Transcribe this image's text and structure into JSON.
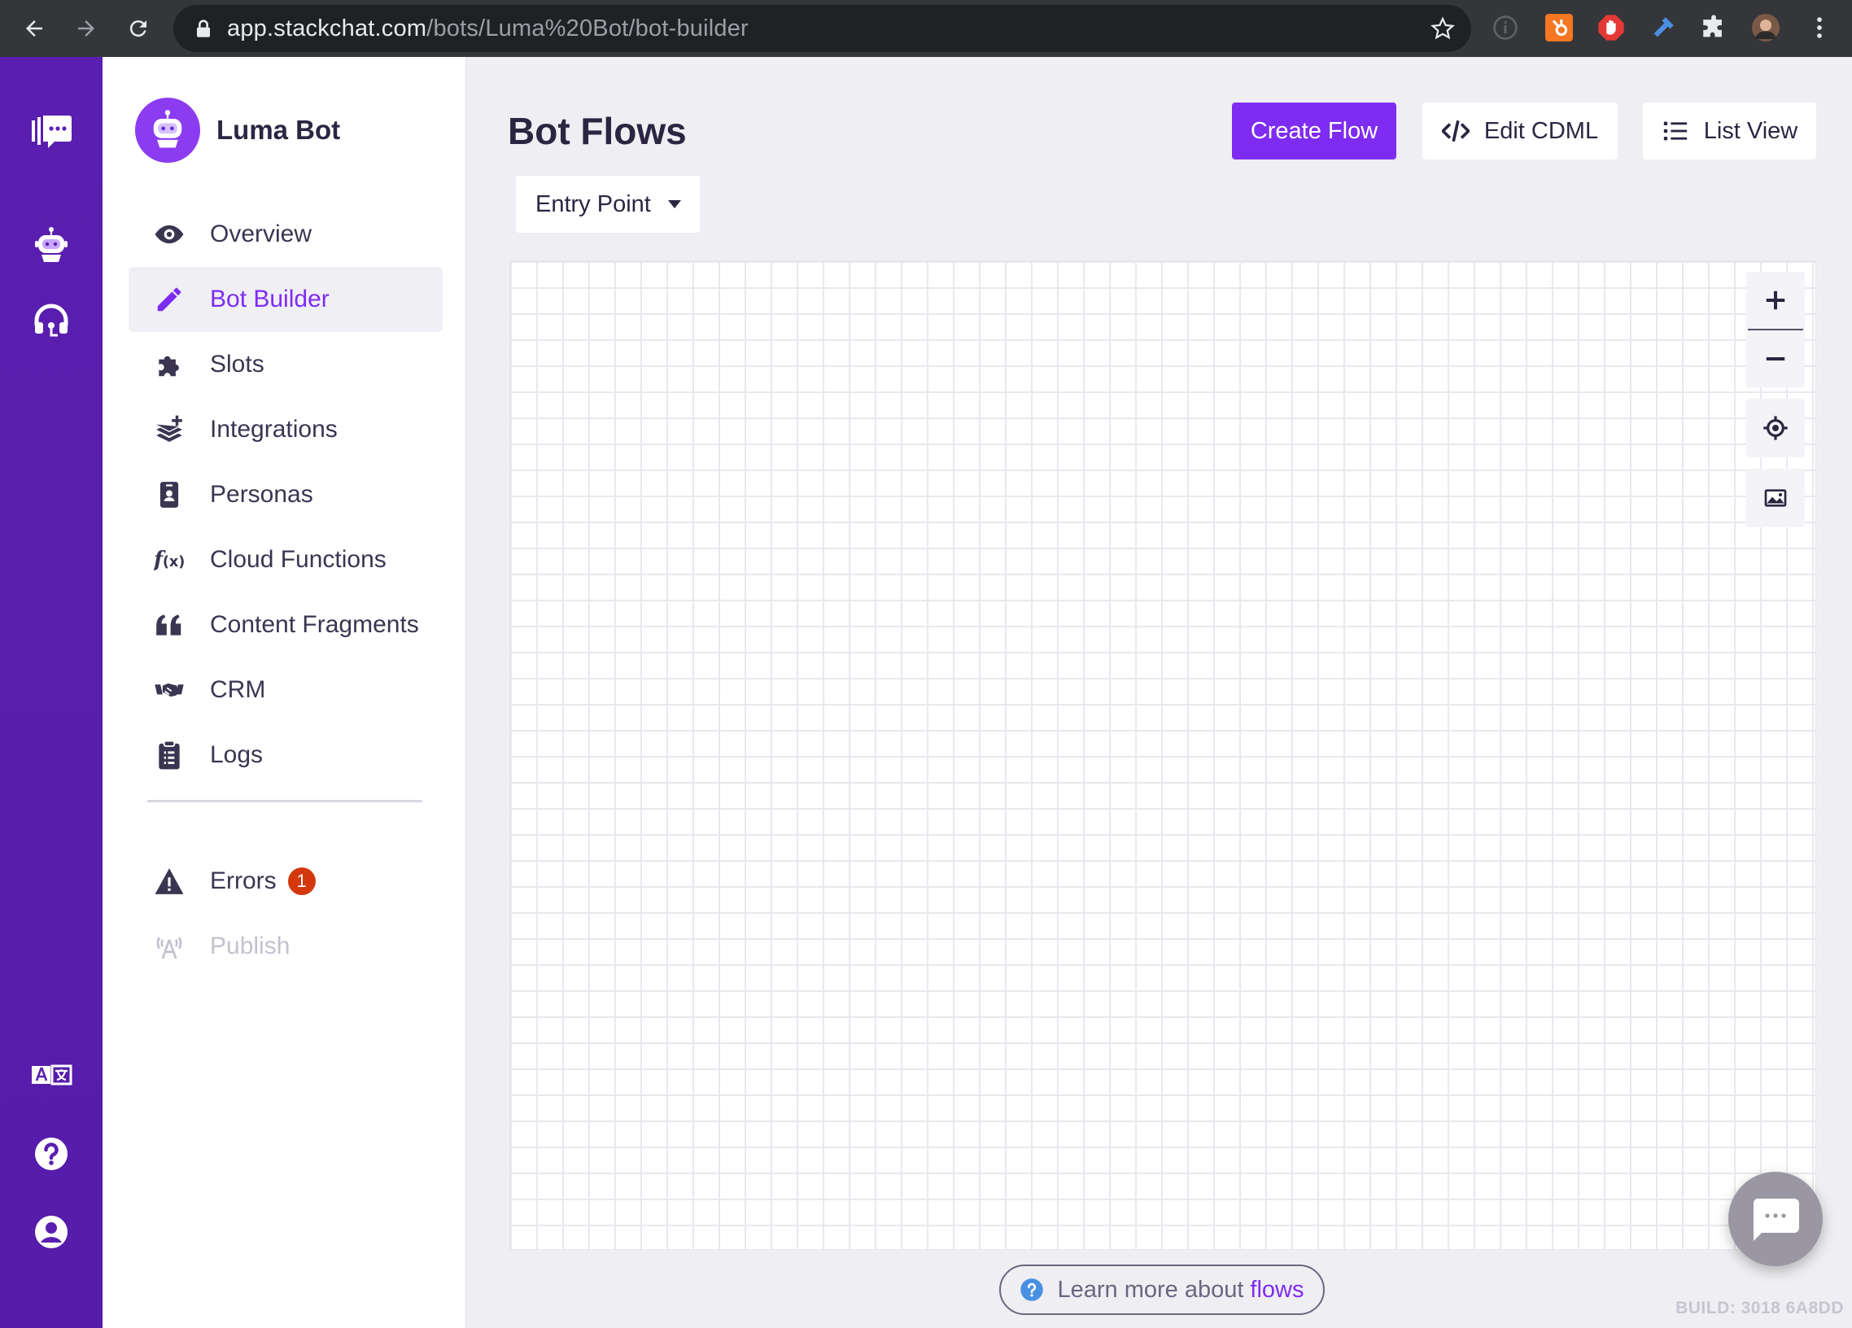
{
  "browser": {
    "url_host": "app.stackchat.com",
    "url_path": "/bots/Luma%20Bot/bot-builder"
  },
  "sidebar": {
    "bot_name": "Luma Bot",
    "items": [
      {
        "label": "Overview",
        "icon": "eye-icon"
      },
      {
        "label": "Bot Builder",
        "icon": "pencil-icon",
        "active": true
      },
      {
        "label": "Slots",
        "icon": "puzzle-icon"
      },
      {
        "label": "Integrations",
        "icon": "layers-plus-icon"
      },
      {
        "label": "Personas",
        "icon": "id-badge-icon"
      },
      {
        "label": "Cloud Functions",
        "icon": "function-icon"
      },
      {
        "label": "Content Fragments",
        "icon": "quote-icon"
      },
      {
        "label": "CRM",
        "icon": "handshake-icon"
      },
      {
        "label": "Logs",
        "icon": "clipboard-list-icon"
      }
    ],
    "errors": {
      "label": "Errors",
      "count": "1"
    },
    "publish": {
      "label": "Publish",
      "disabled": true
    }
  },
  "main": {
    "title": "Bot Flows",
    "create_flow": "Create Flow",
    "edit_cdml": "Edit CDML",
    "list_view": "List View",
    "entry_point": "Entry Point",
    "learn_prefix": "Learn more about",
    "learn_link": "flows",
    "build": "BUILD: 3018 6A8DD"
  },
  "colors": {
    "rail": "#5a1fb0",
    "accent": "#7e2cf2",
    "error_badge": "#d4380d",
    "text": "#2c2542"
  }
}
